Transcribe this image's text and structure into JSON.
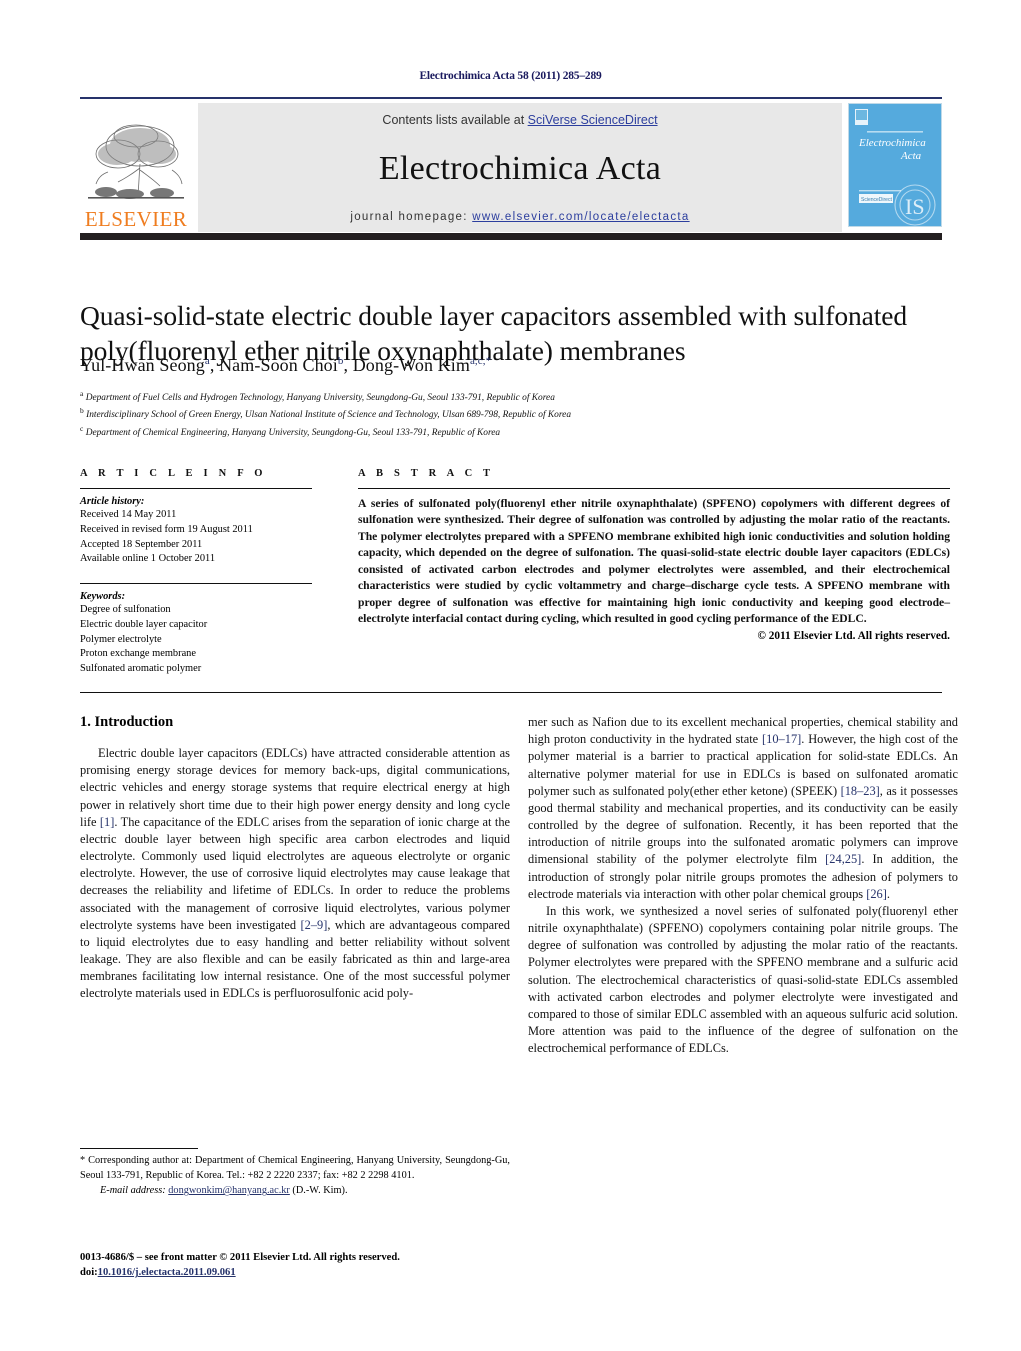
{
  "running_head": "Electrochimica Acta 58 (2011) 285–289",
  "masthead": {
    "publisher_name": "ELSEVIER",
    "contents_prefix": "Contents lists available at ",
    "contents_link": "SciVerse ScienceDirect",
    "journal_name": "Electrochimica Acta",
    "homepage_prefix": "journal homepage: ",
    "homepage_url": "www.elsevier.com/locate/electacta",
    "cover_journal_line1": "Electrochimica",
    "cover_journal_line2": "Acta",
    "accent_orange": "#ef7d20",
    "link_blue": "#2c3e9e",
    "rule_navy": "#26336b",
    "cover_blue": "#55aadd"
  },
  "article": {
    "title": "Quasi-solid-state electric double layer capacitors assembled with sulfonated poly(fluorenyl ether nitrile oxynaphthalate) membranes",
    "authors_html": "Yul-Hwan Seong<sup>a</sup>, Nam-Soon Choi<sup>b</sup>, Dong-Won Kim<sup>a,c,</sup><sup>*</sup>",
    "affiliations": [
      {
        "mark": "a",
        "text": "Department of Fuel Cells and Hydrogen Technology, Hanyang University, Seungdong-Gu, Seoul 133-791, Republic of Korea"
      },
      {
        "mark": "b",
        "text": "Interdisciplinary School of Green Energy, Ulsan National Institute of Science and Technology, Ulsan 689-798, Republic of Korea"
      },
      {
        "mark": "c",
        "text": "Department of Chemical Engineering, Hanyang University, Seungdong-Gu, Seoul 133-791, Republic of Korea"
      }
    ]
  },
  "article_info": {
    "heading": "A R T I C L E    I N F O",
    "history_label": "Article history:",
    "history": [
      "Received 14 May 2011",
      "Received in revised form 19 August 2011",
      "Accepted 18 September 2011",
      "Available online 1 October 2011"
    ],
    "keywords_label": "Keywords:",
    "keywords": [
      "Degree of sulfonation",
      "Electric double layer capacitor",
      "Polymer electrolyte",
      "Proton exchange membrane",
      "Sulfonated aromatic polymer"
    ]
  },
  "abstract": {
    "heading": "A B S T R A C T",
    "text": "A series of sulfonated poly(fluorenyl ether nitrile oxynaphthalate) (SPFENO) copolymers with different degrees of sulfonation were synthesized. Their degree of sulfonation was controlled by adjusting the molar ratio of the reactants. The polymer electrolytes prepared with a SPFENO membrane exhibited high ionic conductivities and solution holding capacity, which depended on the degree of sulfonation. The quasi-solid-state electric double layer capacitors (EDLCs) consisted of activated carbon electrodes and polymer electrolytes were assembled, and their electrochemical characteristics were studied by cyclic voltammetry and charge–discharge cycle tests. A SPFENO membrane with proper degree of sulfonation was effective for maintaining high ionic conductivity and keeping good electrode–electrolyte interfacial contact during cycling, which resulted in good cycling performance of the EDLC.",
    "copyright": "© 2011 Elsevier Ltd. All rights reserved."
  },
  "introduction": {
    "section_title": "1.  Introduction",
    "left_paragraph_html": "Electric double layer capacitors (EDLCs) have attracted considerable attention as promising energy storage devices for memory back-ups, digital communications, electric vehicles and energy storage systems that require electrical energy at high power in relatively short time due to their high power energy density and long cycle life <span class=\"ref\">[1]</span>. The capacitance of the EDLC arises from the separation of ionic charge at the electric double layer between high specific area carbon electrodes and liquid electrolyte. Commonly used liquid electrolytes are aqueous electrolyte or organic electrolyte. However, the use of corrosive liquid electrolytes may cause leakage that decreases the reliability and lifetime of EDLCs. In order to reduce the problems associated with the management of corrosive liquid electrolytes, various polymer electrolyte systems have been investigated <span class=\"ref\">[2–9]</span>, which are advantageous compared to liquid electrolytes due to easy handling and better reliability without solvent leakage. They are also flexible and can be easily fabricated as thin and large-area membranes facilitating low internal resistance. One of the most successful polymer electrolyte materials used in EDLCs is perfluorosulfonic acid poly-",
    "right_paragraph1_html": "mer such as Nafion due to its excellent mechanical properties, chemical stability and high proton conductivity in the hydrated state <span class=\"ref\">[10–17]</span>. However, the high cost of the polymer material is a barrier to practical application for solid-state EDLCs. An alternative polymer material for use in EDLCs is based on sulfonated aromatic polymer such as sulfonated poly(ether ether ketone) (SPEEK) <span class=\"ref\">[18–23]</span>, as it possesses good thermal stability and mechanical properties, and its conductivity can be easily controlled by the degree of sulfonation. Recently, it has been reported that the introduction of nitrile groups into the sulfonated aromatic polymers can improve dimensional stability of the polymer electrolyte film <span class=\"ref\">[24,25]</span>. In addition, the introduction of strongly polar nitrile groups promotes the adhesion of polymers to electrode materials via interaction with other polar chemical groups <span class=\"ref\">[26]</span>.",
    "right_paragraph2_html": "In this work, we synthesized a novel series of sulfonated poly(fluorenyl ether nitrile oxynaphthalate) (SPFENO) copolymers containing polar nitrile groups. The degree of sulfonation was controlled by adjusting the molar ratio of the reactants. Polymer electrolytes were prepared with the SPFENO membrane and a sulfuric acid solution. The electrochemical characteristics of quasi-solid-state EDLCs assembled with activated carbon electrodes and polymer electrolyte were investigated and compared to those of similar EDLC assembled with an aqueous sulfuric acid solution. More attention was paid to the influence of the degree of sulfonation on the electrochemical performance of EDLCs."
  },
  "footnotes": {
    "corresponding_html": "* Corresponding author at: Department of Chemical Engineering, Hanyang University, Seungdong-Gu, Seoul 133-791, Republic of Korea. Tel.: +82  2 2220 2337; fax: +82 2 2298 4101.",
    "email_label": "E-mail address:",
    "email_link": "dongwonkim@hanyang.ac.kr",
    "email_suffix": "(D.-W. Kim).",
    "imprint_line1": "0013-4686/$ – see front matter © 2011 Elsevier Ltd. All rights reserved.",
    "doi_label": "doi:",
    "doi_value": "10.1016/j.electacta.2011.09.061"
  }
}
